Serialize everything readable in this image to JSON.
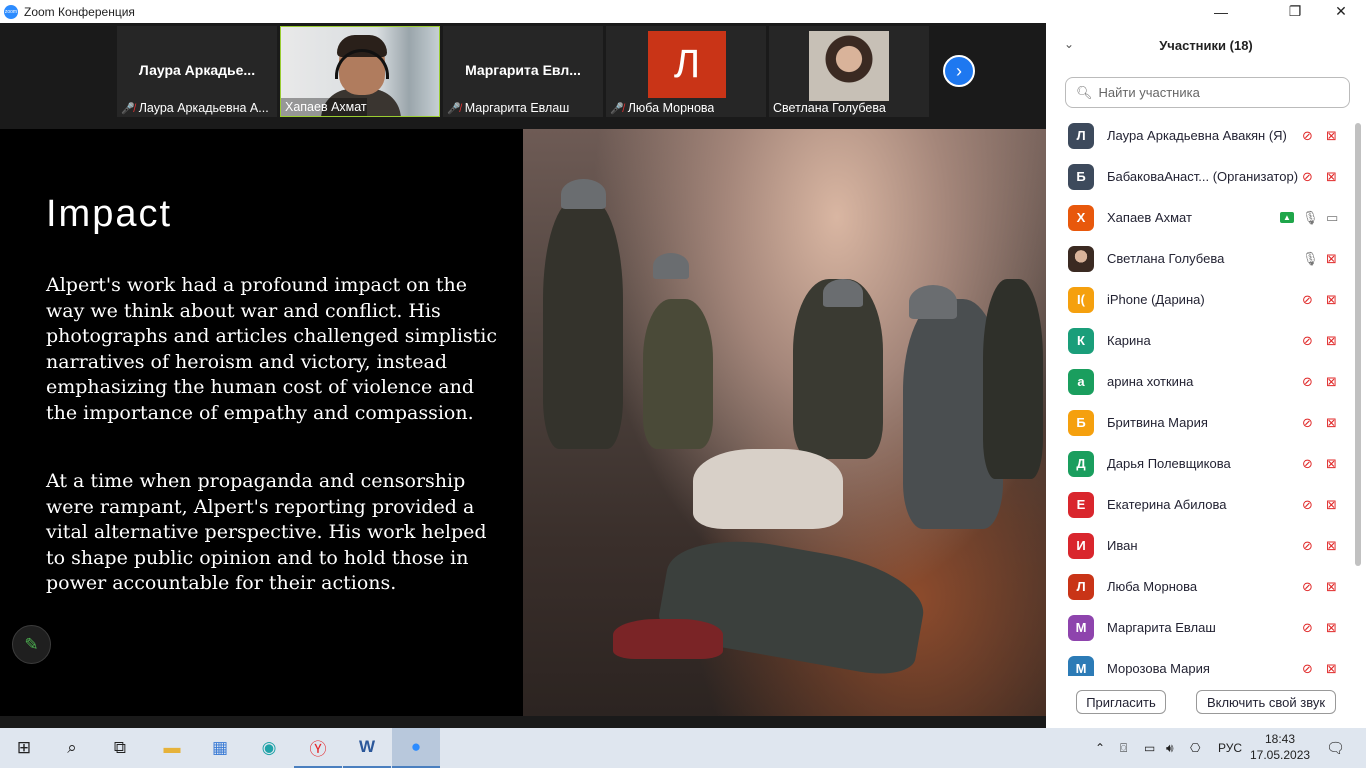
{
  "window": {
    "title": "Zoom Конференция",
    "minimize": "—",
    "maximize": "❐",
    "close": "✕"
  },
  "video_strip": {
    "tiles": [
      {
        "big_name": "Лаура  Аркадье...",
        "footer": "Лаура Аркадьевна А..."
      },
      {
        "footer": "Хапаев Ахмат"
      },
      {
        "big_name": "Маргарита  Евл...",
        "footer": "Маргарита Евлаш"
      },
      {
        "avatar_letter": "Л",
        "footer": "Люба Морнова"
      },
      {
        "footer": "Светлана Голубева"
      }
    ],
    "next_arrow": "›"
  },
  "slide": {
    "heading": "Impact",
    "paragraph1": "Alpert's work had a profound impact on the way we think about war and conflict. His photographs and articles challenged simplistic narratives of heroism and victory, instead emphasizing the human cost of violence and the importance of empathy and compassion.",
    "paragraph2": "At a time when propaganda and censorship were rampant, Alpert's reporting provided a vital alternative perspective. His work helped to shape public opinion and to hold those in power accountable for their actions."
  },
  "participants": {
    "header": "Участники (18)",
    "search_placeholder": "Найти участника",
    "items": [
      {
        "initial": "Л",
        "name": "Лаура Аркадьевна Авакян (Я)",
        "color": "#3d4a5c",
        "mic": "off",
        "cam": "off"
      },
      {
        "initial": "Б",
        "name": "БабаковаАнаст...  (Организатор)",
        "color": "#3d4a5c",
        "mic": "off",
        "cam": "off"
      },
      {
        "initial": "Х",
        "name": "Хапаев Ахмат",
        "color": "#e8580c",
        "mic": "on",
        "cam": "on",
        "share": true
      },
      {
        "initial": "",
        "name": "Светлана Голубева",
        "color": "#6b4a3a",
        "mic": "on",
        "cam": "off",
        "photo": true
      },
      {
        "initial": "I(",
        "name": "iPhone (Дарина)",
        "color": "#f5a00e",
        "mic": "off",
        "cam": "off"
      },
      {
        "initial": "К",
        "name": "Карина",
        "color": "#1a9e7a",
        "mic": "off",
        "cam": "off"
      },
      {
        "initial": "а",
        "name": "арина хоткина",
        "color": "#1a9e5e",
        "mic": "off",
        "cam": "off"
      },
      {
        "initial": "Б",
        "name": "Бритвина Мария",
        "color": "#f5a00e",
        "mic": "off",
        "cam": "off"
      },
      {
        "initial": "Д",
        "name": "Дарья Полевщикова",
        "color": "#1a9e5e",
        "mic": "off",
        "cam": "off"
      },
      {
        "initial": "Е",
        "name": "Екатерина Абилова",
        "color": "#d9262d",
        "mic": "off",
        "cam": "off"
      },
      {
        "initial": "И",
        "name": "Иван",
        "color": "#d9262d",
        "mic": "off",
        "cam": "off"
      },
      {
        "initial": "Л",
        "name": "Люба Морнова",
        "color": "#c93417",
        "mic": "off",
        "cam": "off"
      },
      {
        "initial": "М",
        "name": "Маргарита Евлаш",
        "color": "#8e44ad",
        "mic": "off",
        "cam": "off"
      },
      {
        "initial": "М",
        "name": "Морозова Мария",
        "color": "#2c7bb6",
        "mic": "off",
        "cam": "off"
      }
    ],
    "invite_button": "Пригласить",
    "unmute_button": "Включить свой звук"
  },
  "taskbar": {
    "lang": "РУС",
    "time": "18:43",
    "date": "17.05.2023"
  }
}
